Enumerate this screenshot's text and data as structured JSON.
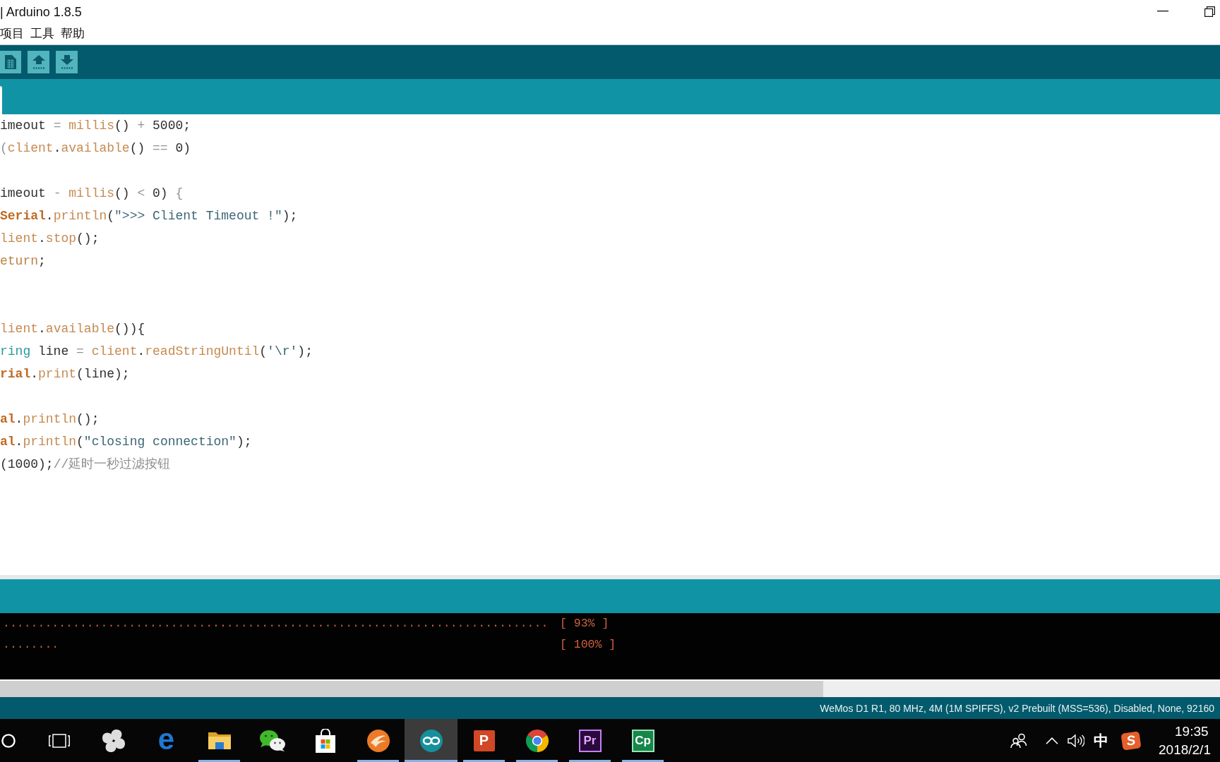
{
  "window": {
    "title": "| Arduino 1.8.5"
  },
  "menu": [
    "项目",
    "工具",
    "帮助"
  ],
  "tabs": [
    {
      "selected": true
    }
  ],
  "editor": {
    "lines": [
      {
        "kind": "code",
        "tokens": [
          {
            "text": "imeout ",
            "kind": "plain"
          },
          {
            "text": "= ",
            "kind": "op"
          },
          {
            "text": "millis",
            "kind": "fn"
          },
          {
            "text": "() ",
            "kind": "plain"
          },
          {
            "text": "+ ",
            "kind": "op"
          },
          {
            "text": "5000;",
            "kind": "plain"
          }
        ]
      },
      {
        "kind": "code",
        "tokens": [
          {
            "text": "(",
            "kind": "op"
          },
          {
            "text": "client",
            "kind": "fn"
          },
          {
            "text": ".",
            "kind": "plain"
          },
          {
            "text": "available",
            "kind": "fn"
          },
          {
            "text": "() ",
            "kind": "plain"
          },
          {
            "text": "== ",
            "kind": "op"
          },
          {
            "text": "0)",
            "kind": "plain"
          }
        ]
      },
      {
        "kind": "blank"
      },
      {
        "kind": "code",
        "tokens": [
          {
            "text": "imeout ",
            "kind": "plain"
          },
          {
            "text": "- ",
            "kind": "op"
          },
          {
            "text": "millis",
            "kind": "fn"
          },
          {
            "text": "() ",
            "kind": "plain"
          },
          {
            "text": "< ",
            "kind": "op"
          },
          {
            "text": "0) ",
            "kind": "plain"
          },
          {
            "text": "{",
            "kind": "op"
          }
        ]
      },
      {
        "kind": "code",
        "tokens": [
          {
            "text": "Serial",
            "kind": "cls"
          },
          {
            "text": ".",
            "kind": "plain"
          },
          {
            "text": "println",
            "kind": "fn"
          },
          {
            "text": "(",
            "kind": "plain"
          },
          {
            "text": "\">>> Client Timeout !\"",
            "kind": "str"
          },
          {
            "text": ");",
            "kind": "plain"
          }
        ]
      },
      {
        "kind": "code",
        "tokens": [
          {
            "text": "lient",
            "kind": "fn"
          },
          {
            "text": ".",
            "kind": "plain"
          },
          {
            "text": "stop",
            "kind": "fn"
          },
          {
            "text": "();",
            "kind": "plain"
          }
        ]
      },
      {
        "kind": "code",
        "tokens": [
          {
            "text": "eturn",
            "kind": "kw"
          },
          {
            "text": ";",
            "kind": "plain"
          }
        ]
      },
      {
        "kind": "blank"
      },
      {
        "kind": "blank"
      },
      {
        "kind": "code",
        "tokens": [
          {
            "text": "lient",
            "kind": "fn"
          },
          {
            "text": ".",
            "kind": "plain"
          },
          {
            "text": "available",
            "kind": "fn"
          },
          {
            "text": "()){",
            "kind": "plain"
          }
        ]
      },
      {
        "kind": "code",
        "tokens": [
          {
            "text": "ring",
            "kind": "type"
          },
          {
            "text": " line ",
            "kind": "plain"
          },
          {
            "text": "= ",
            "kind": "op"
          },
          {
            "text": "client",
            "kind": "fn"
          },
          {
            "text": ".",
            "kind": "plain"
          },
          {
            "text": "readStringUntil",
            "kind": "fn"
          },
          {
            "text": "(",
            "kind": "plain"
          },
          {
            "text": "'\\r'",
            "kind": "str"
          },
          {
            "text": ");",
            "kind": "plain"
          }
        ]
      },
      {
        "kind": "code",
        "tokens": [
          {
            "text": "rial",
            "kind": "cls"
          },
          {
            "text": ".",
            "kind": "plain"
          },
          {
            "text": "print",
            "kind": "fn"
          },
          {
            "text": "(line);",
            "kind": "plain"
          }
        ]
      },
      {
        "kind": "blank"
      },
      {
        "kind": "code",
        "tokens": [
          {
            "text": "al",
            "kind": "cls"
          },
          {
            "text": ".",
            "kind": "plain"
          },
          {
            "text": "println",
            "kind": "fn"
          },
          {
            "text": "();",
            "kind": "plain"
          }
        ]
      },
      {
        "kind": "code",
        "tokens": [
          {
            "text": "al",
            "kind": "cls"
          },
          {
            "text": ".",
            "kind": "plain"
          },
          {
            "text": "println",
            "kind": "fn"
          },
          {
            "text": "(",
            "kind": "plain"
          },
          {
            "text": "\"closing connection\"",
            "kind": "str"
          },
          {
            "text": ");",
            "kind": "plain"
          }
        ]
      },
      {
        "kind": "code",
        "tokens": [
          {
            "text": "(1000);",
            "kind": "plain"
          },
          {
            "text": "//延时一秒过滤按钮",
            "kind": "comment"
          }
        ]
      }
    ]
  },
  "console": {
    "lines": [
      {
        "dots": "..............................................................................",
        "progress": "[ 93% ]"
      },
      {
        "dots": "........",
        "progress": "[ 100% ]"
      }
    ]
  },
  "status_bar": {
    "board": "WeMos D1 R1, 80 MHz, 4M (1M SPIFFS), v2 Prebuilt (MSS=536), Disabled, None, 92160"
  },
  "taskbar": {
    "apps": [
      {
        "running": false,
        "selected": false
      },
      {
        "running": false,
        "selected": false,
        "label": "e"
      },
      {
        "running": true,
        "selected": false
      },
      {
        "running": false,
        "selected": false
      },
      {
        "running": false,
        "selected": false
      },
      {
        "running": true,
        "selected": false
      },
      {
        "running": true,
        "selected": true
      },
      {
        "running": true,
        "selected": false,
        "label": "P"
      },
      {
        "running": true,
        "selected": false
      },
      {
        "running": true,
        "selected": false,
        "label": "Pr"
      },
      {
        "running": true,
        "selected": false,
        "label": "Cp"
      }
    ],
    "tray": {
      "input_mode": "中",
      "ime_logo": "S"
    },
    "clock": {
      "time": "19:35",
      "date": "2018/2/1"
    }
  }
}
